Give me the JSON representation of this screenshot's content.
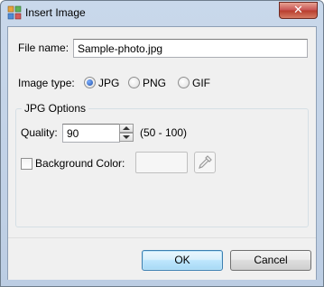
{
  "window": {
    "title": "Insert Image",
    "close_glyph": "✕"
  },
  "file": {
    "label": "File name:",
    "value": "Sample-photo.jpg"
  },
  "image_type": {
    "label": "Image type:",
    "options": [
      {
        "label": "JPG",
        "checked": true
      },
      {
        "label": "PNG",
        "checked": false
      },
      {
        "label": "GIF",
        "checked": false
      }
    ]
  },
  "jpg_options": {
    "title": "JPG Options",
    "quality_label": "Quality:",
    "quality_value": "90",
    "quality_range": "(50 - 100)",
    "background_label": "Background Color:",
    "background_checked": false
  },
  "buttons": {
    "ok": "OK",
    "cancel": "Cancel"
  },
  "icons": {
    "app": "app-icon",
    "close": "close-icon",
    "spin_up": "spin-up-icon",
    "spin_down": "spin-down-icon",
    "eyedropper": "eyedropper-icon"
  },
  "colors": {
    "titlebar": "#c9d8eb",
    "client": "#f0f0f0",
    "close_button": "#c75050",
    "default_button_border": "#3c7fb1"
  }
}
